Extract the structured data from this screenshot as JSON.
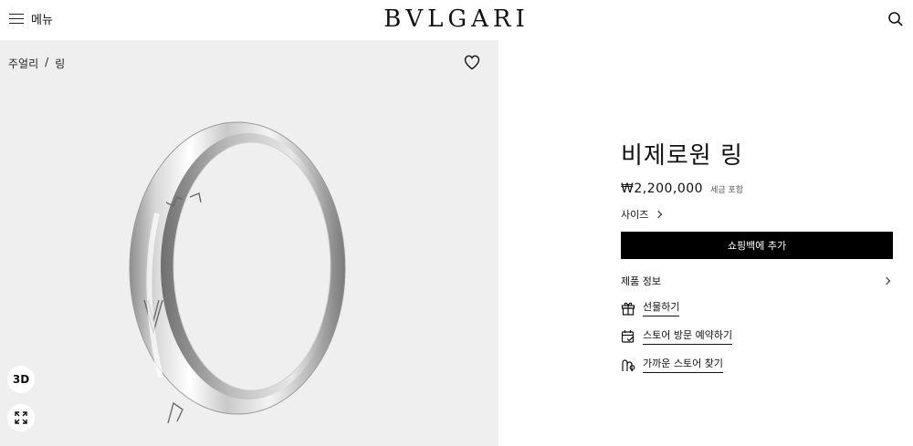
{
  "header": {
    "menu_label": "메뉴",
    "logo_text": "BVLGARI"
  },
  "gallery": {
    "breadcrumb": [
      "주얼리",
      "/",
      "링"
    ],
    "btn_3d": "3D"
  },
  "product": {
    "title": "비제로원 링",
    "price": "₩2,200,000",
    "tax_note": "세금 포함",
    "size_label": "사이즈",
    "add_to_bag": "쇼핑백에 추가",
    "details_label": "제품 정보",
    "links": [
      {
        "label": "선물하기",
        "icon": "gift-icon"
      },
      {
        "label": "스토어 방문 예약하기",
        "icon": "calendar-icon"
      },
      {
        "label": "가까운 스토어 찾기",
        "icon": "store-locator-icon"
      }
    ]
  }
}
